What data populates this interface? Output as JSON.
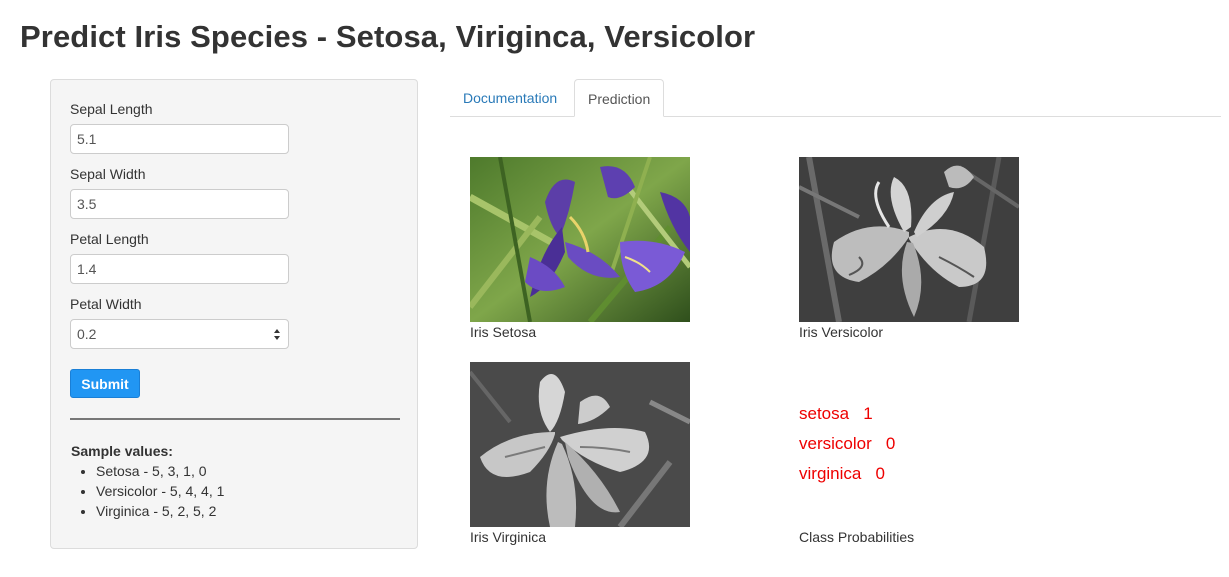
{
  "page": {
    "title": "Predict Iris Species - Setosa, Viriginca, Versicolor"
  },
  "sidebar": {
    "fields": [
      {
        "label": "Sepal Length",
        "value": "5.1"
      },
      {
        "label": "Sepal Width",
        "value": "3.5"
      },
      {
        "label": "Petal Length",
        "value": "1.4"
      },
      {
        "label": "Petal Width",
        "value": "0.2"
      }
    ],
    "submit_label": "Submit",
    "sample_title": "Sample values:",
    "samples": [
      "Setosa - 5, 3, 1, 0",
      "Versicolor - 5, 4, 4, 1",
      "Virginica - 5, 2, 5, 2"
    ]
  },
  "tabs": [
    {
      "label": "Documentation",
      "active": false
    },
    {
      "label": "Prediction",
      "active": true
    }
  ],
  "images": [
    {
      "caption": "Iris Setosa",
      "icon": "setosa-photo"
    },
    {
      "caption": "Iris Versicolor",
      "icon": "versicolor-photo"
    },
    {
      "caption": "Iris Virginica",
      "icon": "virginica-photo"
    }
  ],
  "probabilities": [
    {
      "name": "setosa",
      "value": "1"
    },
    {
      "name": "versicolor",
      "value": "0"
    },
    {
      "name": "virginica",
      "value": "0"
    }
  ],
  "probabilities_caption": "Class Probabilities",
  "colors": {
    "accent": "#2196f3",
    "probability_text": "#ee0000",
    "tab_link": "#2a7ab8"
  }
}
